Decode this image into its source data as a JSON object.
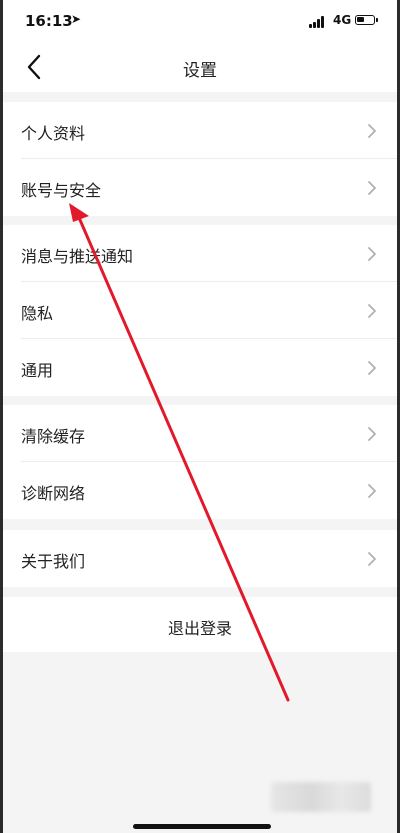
{
  "status": {
    "time": "16:13",
    "location_glyph": "➤",
    "network": "4G"
  },
  "nav": {
    "title": "设置"
  },
  "groups": [
    {
      "items": [
        {
          "label": "个人资料"
        },
        {
          "label": "账号与安全"
        }
      ]
    },
    {
      "items": [
        {
          "label": "消息与推送通知"
        },
        {
          "label": "隐私"
        },
        {
          "label": "通用"
        }
      ]
    },
    {
      "items": [
        {
          "label": "清除缓存"
        },
        {
          "label": "诊断网络"
        }
      ]
    },
    {
      "items": [
        {
          "label": "关于我们"
        }
      ]
    }
  ],
  "logout": {
    "label": "退出登录"
  },
  "colors": {
    "background": "#f4f4f4",
    "row": "#ffffff",
    "text": "#222222",
    "chevron": "#b0b0b0",
    "annotation": "#e2192b"
  },
  "icons": {
    "back": "chevron-left-icon",
    "row_arrow": "chevron-right-icon",
    "signal": "signal-icon",
    "battery": "battery-icon",
    "location": "location-arrow-icon"
  }
}
